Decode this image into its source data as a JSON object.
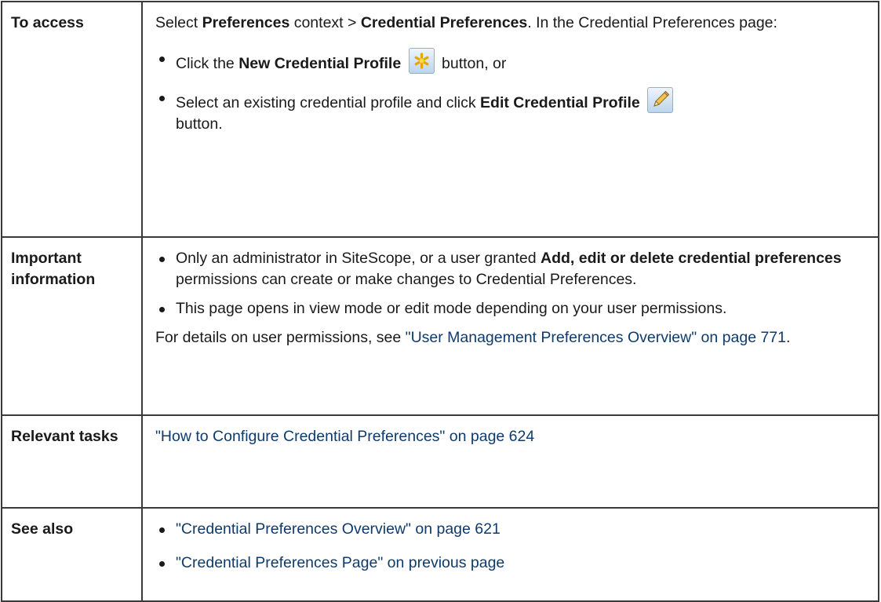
{
  "rows": [
    {
      "label": "To access",
      "intro": {
        "t1": "Select ",
        "b1": "Preferences",
        "t2": " context > ",
        "b2": "Credential Preferences",
        "t3": ". In the Credential Preferences page:"
      },
      "bullets": [
        {
          "t1": "Click the ",
          "b1": "New Credential Profile",
          "icon": "new-profile-icon",
          "t2": " button, or"
        },
        {
          "t1": "Select an existing credential profile and click ",
          "b1": "Edit Credential Profile",
          "icon": "edit-pencil-icon",
          "t2": " button."
        }
      ]
    },
    {
      "label": "Important information",
      "bullets": [
        {
          "t1": "Only an administrator in SiteScope, or a user granted ",
          "b1": "Add, edit or delete credential preferences",
          "t2": " permissions can create or make changes to Credential Preferences."
        },
        {
          "t1": "This page opens in view mode or edit mode depending on your user permissions."
        }
      ],
      "note": {
        "text": "For details on user permissions, see ",
        "link": "\"User Management Preferences Overview\" on page 771",
        "end": "."
      }
    },
    {
      "label": "Relevant tasks",
      "link": "\"How to Configure Credential Preferences\" on page 624"
    },
    {
      "label": "See also",
      "links": [
        "\"Credential Preferences Overview\" on page 621",
        "\"Credential Preferences Page\" on previous page"
      ]
    }
  ],
  "colors": {
    "link": "#0e3b6b",
    "text": "#1a1a1a",
    "border": "#3a3a3a"
  }
}
